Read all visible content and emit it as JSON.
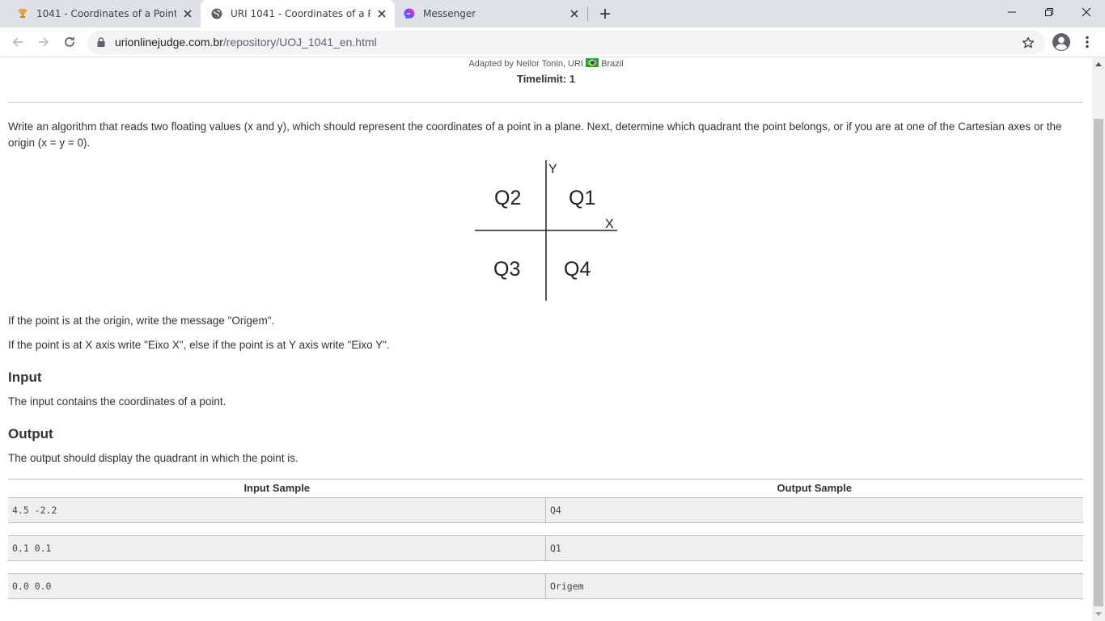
{
  "browser": {
    "tabs": [
      {
        "title": "1041 - Coordinates of a Point - U",
        "icon": "trophy-icon",
        "active": false
      },
      {
        "title": "URI 1041 - Coordinates of a Poin",
        "icon": "globe-icon",
        "active": true
      },
      {
        "title": "Messenger",
        "icon": "messenger-icon",
        "active": false
      }
    ],
    "url_domain": "urionlinejudge.com.br",
    "url_path": "/repository/UOJ_1041_en.html"
  },
  "problem": {
    "adapted_by": "Adapted by Neilor Tonin, URI",
    "country": "Brazil",
    "timelimit": "Timelimit: 1",
    "description": "Write an algorithm that reads two floating values (x and y), which should represent the coordinates of a point in a plane. Next, determine which quadrant the point belongs, or if you are at one of the Cartesian axes or the origin (x = y = 0).",
    "diagram": {
      "y_label": "Y",
      "x_label": "X",
      "q1": "Q1",
      "q2": "Q2",
      "q3": "Q3",
      "q4": "Q4"
    },
    "origin_rule": "If the point is at the origin, write the message \"Origem\".",
    "axis_rule": "If the point is at X axis write \"Eixo X\", else if the point is at Y axis write \"Eixo Y\".",
    "input_heading": "Input",
    "input_text": "The input contains the coordinates of a point.",
    "output_heading": "Output",
    "output_text": "The output should display the quadrant in which the point is.",
    "samples_header": {
      "input": "Input Sample",
      "output": "Output Sample"
    },
    "samples": [
      {
        "input": "4.5 -2.2",
        "output": "Q4"
      },
      {
        "input": "0.1 0.1",
        "output": "Q1"
      },
      {
        "input": "0.0 0.0",
        "output": "Origem"
      }
    ]
  }
}
